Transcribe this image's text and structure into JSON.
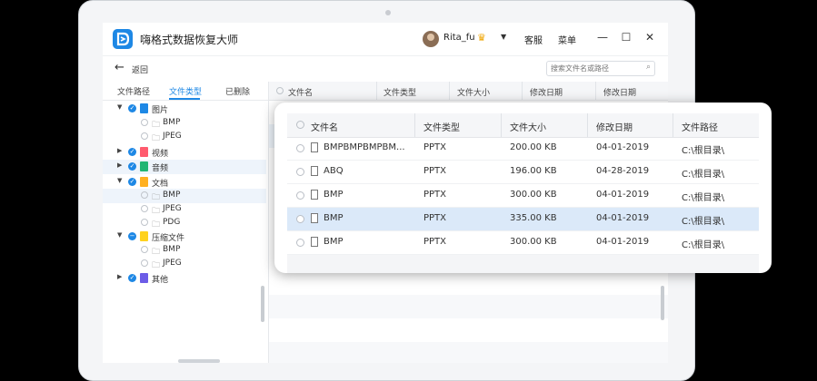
{
  "app": {
    "title": "嗨格式数据恢复大师"
  },
  "user": {
    "name": "Rita_fu"
  },
  "header": {
    "customer_service": "客服",
    "menu": "菜单"
  },
  "toolbar": {
    "back_label": "返回",
    "search_placeholder": "搜索文件名或路径"
  },
  "left_tabs": [
    "文件路径",
    "文件类型",
    "已删除"
  ],
  "active_tab": "文件类型",
  "tree": [
    {
      "label": "图片",
      "icon_color": "#1e88e5",
      "children": [
        "BMP",
        "JPEG"
      ]
    },
    {
      "label": "视频",
      "icon_color": "#ff5b6e"
    },
    {
      "label": "音频",
      "icon_color": "#22b573"
    },
    {
      "label": "文档",
      "icon_color": "#ffb020",
      "children": [
        "BMP",
        "JPEG",
        "PDG"
      ]
    },
    {
      "label": "压缩文件",
      "icon_color": "#ffd21f",
      "children": [
        "BMP",
        "JPEG"
      ]
    },
    {
      "label": "其他",
      "icon_color": "#6c5ce7"
    }
  ],
  "table_headers": [
    "文件名",
    "文件类型",
    "文件大小",
    "修改日期",
    "修改日期"
  ],
  "card": {
    "headers": [
      "文件名",
      "文件类型",
      "文件大小",
      "修改日期",
      "文件路径"
    ],
    "rows": [
      {
        "name": "BMPBMPBMPBM...",
        "type": "PPTX",
        "size": "200.00 KB",
        "date": "04-01-2019",
        "path": "C:\\根目录\\"
      },
      {
        "name": "ABQ",
        "type": "PPTX",
        "size": "196.00 KB",
        "date": "04-28-2019",
        "path": "C:\\根目录\\"
      },
      {
        "name": "BMP",
        "type": "PPTX",
        "size": "300.00 KB",
        "date": "04-01-2019",
        "path": "C:\\根目录\\"
      },
      {
        "name": "BMP",
        "type": "PPTX",
        "size": "335.00 KB",
        "date": "04-01-2019",
        "path": "C:\\根目录\\"
      },
      {
        "name": "BMP",
        "type": "PPTX",
        "size": "300.00 KB",
        "date": "04-01-2019",
        "path": "C:\\根目录\\"
      }
    ],
    "selected_row": 3
  },
  "colors": {
    "accent": "#1e88e5",
    "selected_row": "#dbe9f9"
  }
}
